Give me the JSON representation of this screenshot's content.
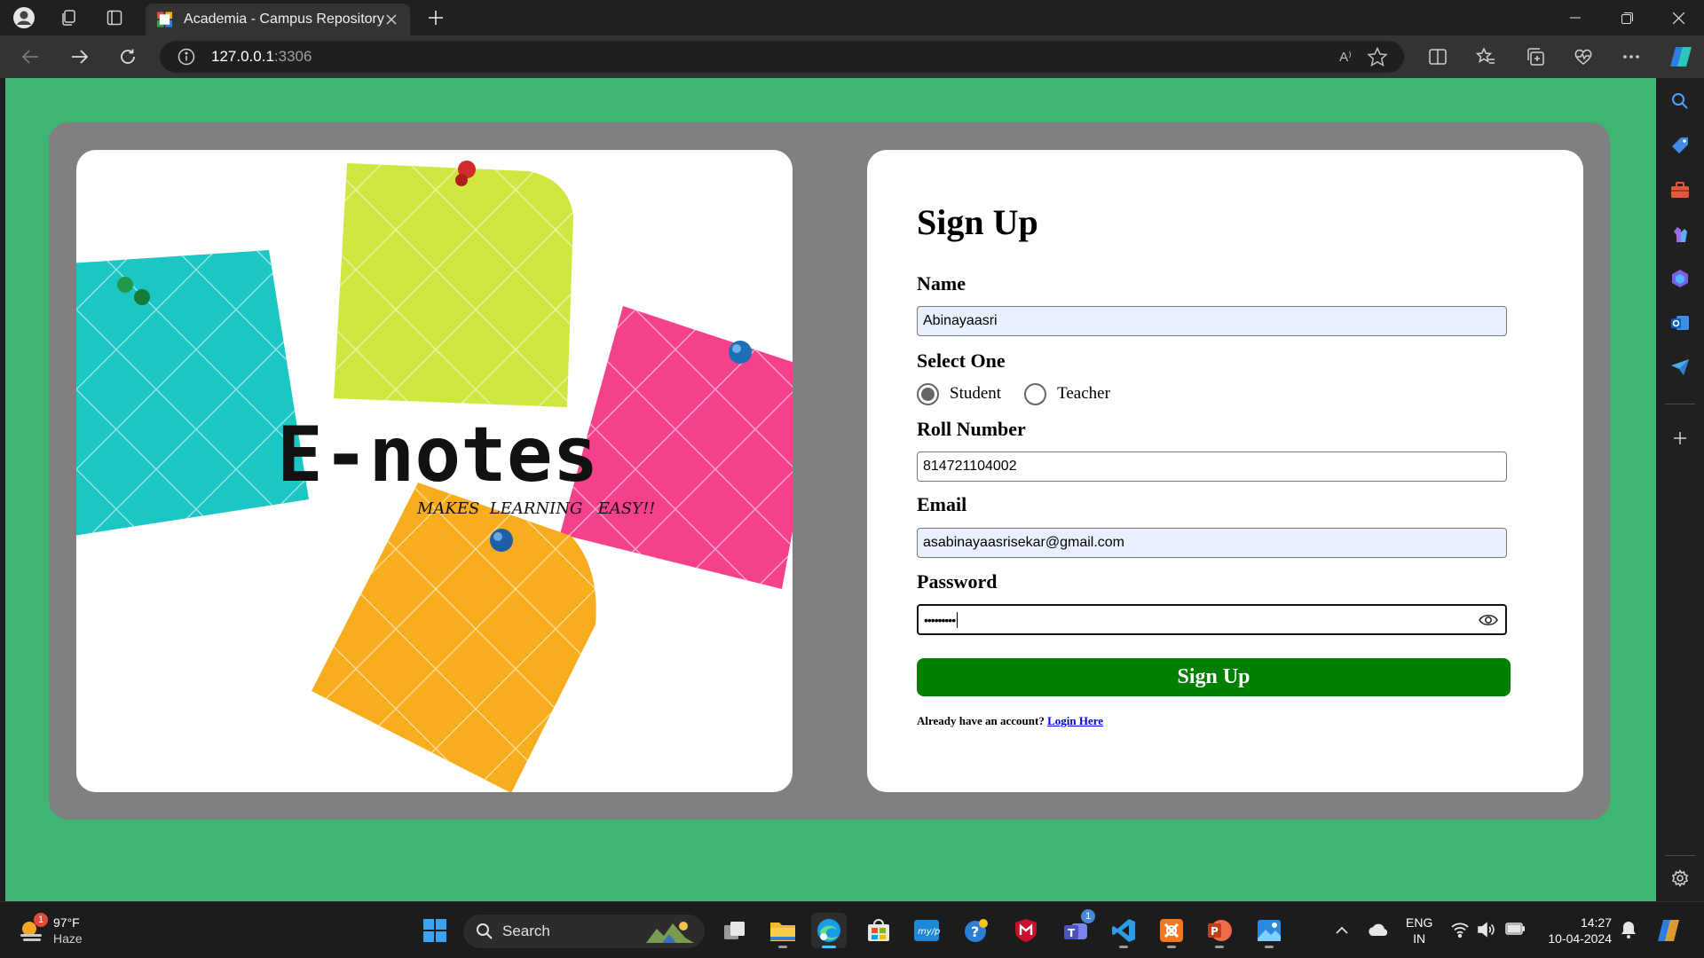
{
  "browser": {
    "tab_title": "Academia - Campus Repository",
    "url_host": "127.0.0.1",
    "url_port": ":3306",
    "read_aloud_label": "A⁾"
  },
  "logo": {
    "title": "E-notes",
    "tagline": "MAKES  LEARNING   EASY!!"
  },
  "form": {
    "title": "Sign Up",
    "name_label": "Name",
    "name_value": "Abinayaasri",
    "role_label": "Select One",
    "role_options": [
      "Student",
      "Teacher"
    ],
    "role_selected": "Student",
    "roll_label": "Roll Number",
    "roll_value": "814721104002",
    "email_label": "Email",
    "email_value": "asabinayaasrisekar@gmail.com",
    "password_label": "Password",
    "password_masked": "•••••••••",
    "submit_label": "Sign Up",
    "login_prompt": "Already have an account?",
    "login_link": "Login Here"
  },
  "taskbar": {
    "weather_temp": "97°F",
    "weather_condition": "Haze",
    "weather_badge": "1",
    "search_label": "Search",
    "teams_badge": "1",
    "lang_line1": "ENG",
    "lang_line2": "IN",
    "time": "14:27",
    "date": "10-04-2024"
  },
  "colors": {
    "page_background": "#3fb573",
    "panel_gray": "#808080",
    "submit_green": "#008000",
    "autofill_blue": "#e8f0fe",
    "link_blue": "#0000ee"
  }
}
